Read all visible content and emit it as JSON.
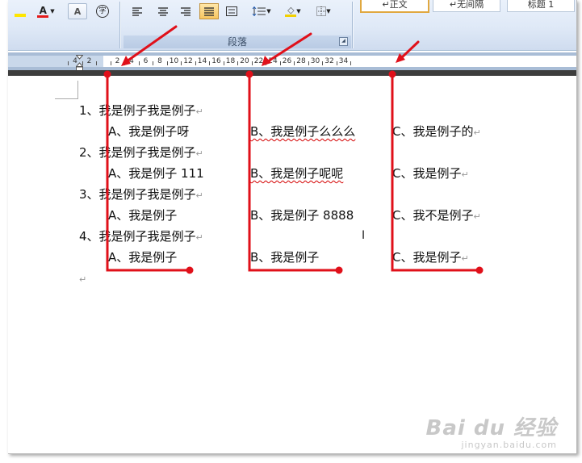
{
  "ribbon": {
    "paragraph_group_label": "段落",
    "font_color_label": "A",
    "char_border_label": "A",
    "encircle_label": "字",
    "style_normal": "↵正文",
    "style_no_spacing": "↵无间隔",
    "style_heading1": "标题 1"
  },
  "ruler": {
    "left_labels": [
      "4",
      "2"
    ],
    "right_labels": [
      "2",
      "4",
      "6",
      "8",
      "10",
      "12",
      "14",
      "16",
      "18",
      "20",
      "22",
      "24",
      "26",
      "28",
      "30",
      "32",
      "34"
    ]
  },
  "document": {
    "paragraph_mark": "↵",
    "questions": [
      {
        "label": "1、我是例子我是例子",
        "options": [
          "A、我是例子呀",
          "B、我是例子么么么",
          "C、我是例子的"
        ]
      },
      {
        "label": "2、我是例子我是例子",
        "options": [
          "A、我是例子 111",
          "B、我是例子呢呢",
          "C、我是例子"
        ]
      },
      {
        "label": "3、我是例子我是例子",
        "options": [
          "A、我是例子",
          "B、我是例子 8888",
          "C、我不是例子"
        ]
      },
      {
        "label": "4、我是例子我是例子",
        "options": [
          "A、我是例子",
          "B、我是例子",
          "C、我是例子"
        ]
      }
    ]
  },
  "watermark": {
    "logo": "Bai du 经验",
    "url": "jingyan.baidu.com"
  },
  "colors": {
    "annotation": "#e0101a",
    "ribbon": "#dfe9f7",
    "ruler_bg": "#a9bdd6"
  }
}
